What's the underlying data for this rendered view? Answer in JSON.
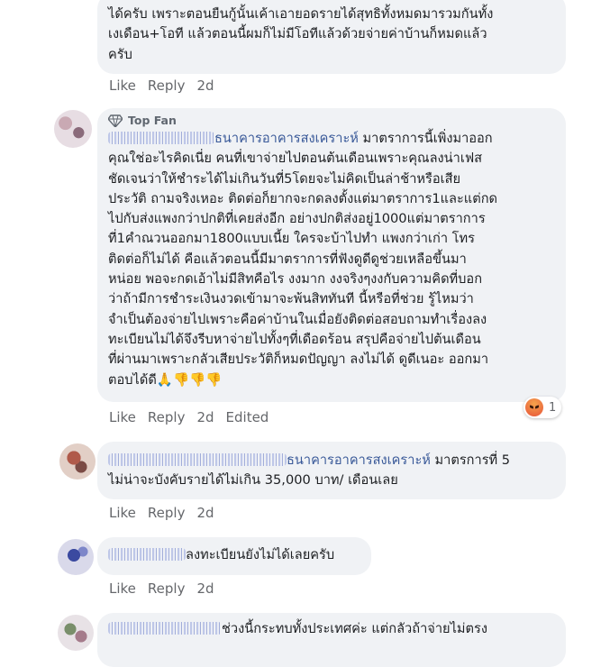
{
  "comments": [
    {
      "text": "ได้ครับ เพราะตอนยืนกู้นั้นเค้าเอายอดรายได้สุทธิทั้งหมดมารวมกันทั้ง\nเงเดือน+โอที แล้วตอนนี้ผมก็ไม่มีโอทีแล้วด้วยจ่ายค่าบ้านก็หมดแล้ว\nครับ",
      "like": "Like",
      "reply": "Reply",
      "time": "2d"
    },
    {
      "badge": "Top Fan",
      "mention": "ธนาคารอาคารสงเคราะห์",
      "first_line": " มาตราการนี้เพิ่งมาออก",
      "text": "คุณใช่อะไรคิดเนี่ย คนที่เขาจ่ายไปตอนต้นเดือนเพราะคุณลงน่าเฟส\nชัดเจนว่าให้ชำระได้ไม่เกินวันที่5โดยจะไม่คิดเป็นล่าช้าหรือเสีย\nประวัติ ถามจริงเหอะ ติดต่อก็ยากจะกดลงตั้งแต่มาตราการ1และแต่กด\nไปกับส่งแพงกว่าปกติที่เคยส่งอีก อย่างปกติส่งอยู่1000แต่มาตราการ\nที่1คำณวนออกมา1800แบบเนี้ย ใครจะบ้าไปทำ แพงกว่าเก่า โทร\nติดต่อก็ไม่ได้ คือแล้วตอนนี้มีมาตราการที่ฟังดูดีดูช่วยเหลือขึ้นมา\nหน่อย พอจะกดเอ้าไม่มีสิทคือไร งงมาก งงจริงๆงงกับความคิดที่บอก\nว่าถ้ามีการชำระเงินงวดเข้ามาจะพ้นสิททันที นี้หรือที่ช่วย รู้ไหมว่า\nจำเป็นต้องจ่ายไปเพราะคือค่าบ้านในเมื่อยังติดต่อสอบถามทำเรื่องลง\nทะเบียนไม่ได้จึงรีบหาจ่ายไปทั้งๆที่เดือดร้อน สรุปคือจ่ายไปต้นเดือน\nที่ผ่านมาเพราะกลัวเสียประวัติก็หมดปัญญา ลงไม่ได้ ดูดีเนอะ ออกมา\nตอบได้ดี🙏👎👎👎",
      "like": "Like",
      "reply": "Reply",
      "time": "2d",
      "edited": "Edited",
      "reaction_count": "1"
    },
    {
      "mention": "ธนาคารอาคารสงเคราะห์",
      "first_line": " มาตรการที่ 5",
      "text": "ไม่น่าจะบังคับรายได้ไม่เกิน 35,000 บาท/ เดือนเลย",
      "like": "Like",
      "reply": "Reply",
      "time": "2d"
    },
    {
      "text": "ลงทะเบียนยังไม่ได้เลยครับ",
      "like": "Like",
      "reply": "Reply",
      "time": "2d"
    },
    {
      "text": "ช่วงนี้กระทบทั้งประเทศค่ะ แต่กลัวถ้าจ่ายไม่ตรง"
    }
  ]
}
